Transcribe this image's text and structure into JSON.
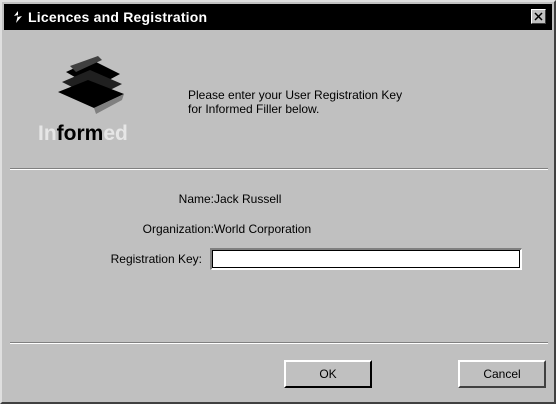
{
  "window": {
    "title": "Licences and Registration"
  },
  "logo": {
    "word_in": "In",
    "word_form": "form",
    "word_ed": "ed",
    "trademark": "®"
  },
  "intro": {
    "line1": "Please enter your User Registration Key",
    "line2": "for Informed Filler below."
  },
  "fields": {
    "name_label": "Name:",
    "name_value": "Jack Russell",
    "organization_label": "Organization:",
    "organization_value": "World Corporation",
    "registration_key_label": "Registration Key:",
    "registration_key_value": ""
  },
  "buttons": {
    "ok_label": "OK",
    "cancel_label": "Cancel"
  },
  "icons": {
    "title": "app-icon",
    "close": "close-icon",
    "logo": "informed-logo"
  }
}
